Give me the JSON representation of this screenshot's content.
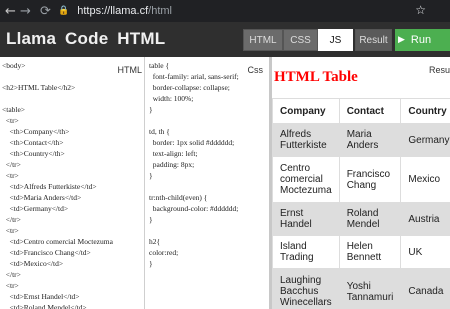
{
  "browser": {
    "url_host": "https://llama.cf",
    "url_path": "/html"
  },
  "app": {
    "title": "Llama Code HTML",
    "tabs": [
      "HTML",
      "CSS",
      "JS",
      "Result"
    ],
    "active_tab": "JS",
    "run_label": "Run",
    "colors": {
      "run": "#4caf50",
      "header": "#2f2f2f",
      "heading": "#ff0000"
    }
  },
  "html_panel": {
    "label": "HTML",
    "code": "<body>\n\n<h2>HTML Table</h2>\n\n<table>\n  <tr>\n    <th>Company</th>\n    <th>Contact</th>\n    <th>Country</th>\n  </tr>\n  <tr>\n    <td>Alfreds Futterkiste</td>\n    <td>Maria Anders</td>\n    <td>Germany</td>\n  </tr>\n  <tr>\n    <td>Centro comercial Moctezuma\n    <td>Francisco Chang</td>\n    <td>Mexico</td>\n  </tr>\n  <tr>\n    <td>Ernst Handel</td>\n    <td>Roland Mendel</td>\n    <td>Austria</td>"
  },
  "css_panel": {
    "label": "Css",
    "code": "table {\n  font-family: arial, sans-serif;\n  border-collapse: collapse;\n  width: 100%;\n}\n\ntd, th {\n  border: 1px solid #dddddd;\n  text-align: left;\n  padding: 8px;\n}\n\ntr:nth-child(even) {\n  background-color: #dddddd;\n}\n\nh2{\ncolor:red;\n}"
  },
  "result_panel": {
    "label": "Resu",
    "heading": "HTML Table",
    "headers": [
      "Company",
      "Contact",
      "Country"
    ],
    "rows": [
      [
        "Alfreds Futterkiste",
        "Maria Anders",
        "Germany"
      ],
      [
        "Centro comercial Moctezuma",
        "Francisco Chang",
        "Mexico"
      ],
      [
        "Ernst Handel",
        "Roland Mendel",
        "Austria"
      ],
      [
        "Island Trading",
        "Helen Bennett",
        "UK"
      ],
      [
        "Laughing Bacchus Winecellars",
        "Yoshi Tannamuri",
        "Canada"
      ]
    ]
  }
}
